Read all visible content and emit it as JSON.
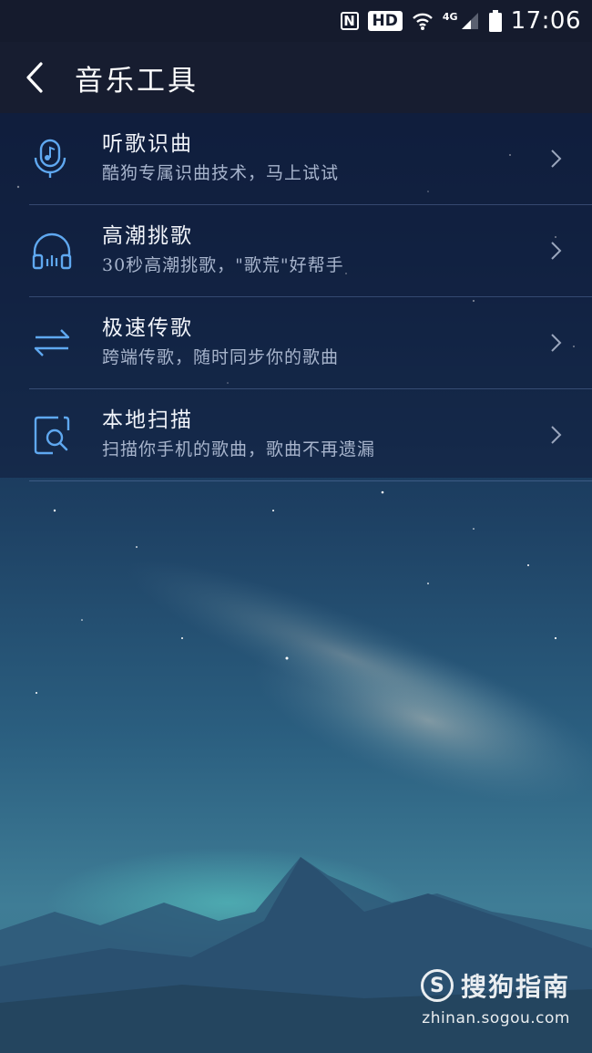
{
  "status_bar": {
    "nfc": "N",
    "hd": "HD",
    "network": "4G",
    "time": "17:06"
  },
  "header": {
    "title": "音乐工具"
  },
  "tools": [
    {
      "icon": "mic-music-icon",
      "title": "听歌识曲",
      "subtitle": "酷狗专属识曲技术，马上试试"
    },
    {
      "icon": "headphones-icon",
      "title": "高潮挑歌",
      "subtitle": "30秒高潮挑歌，\"歌荒\"好帮手"
    },
    {
      "icon": "transfer-arrows-icon",
      "title": "极速传歌",
      "subtitle": "跨端传歌，随时同步你的歌曲"
    },
    {
      "icon": "phone-scan-icon",
      "title": "本地扫描",
      "subtitle": "扫描你手机的歌曲，歌曲不再遗漏"
    }
  ],
  "watermark": {
    "logo": "S",
    "name": "搜狗指南",
    "url": "zhinan.sogou.com"
  },
  "colors": {
    "accent_icon": "#5fa8f0",
    "titlebar": "#171d30"
  }
}
